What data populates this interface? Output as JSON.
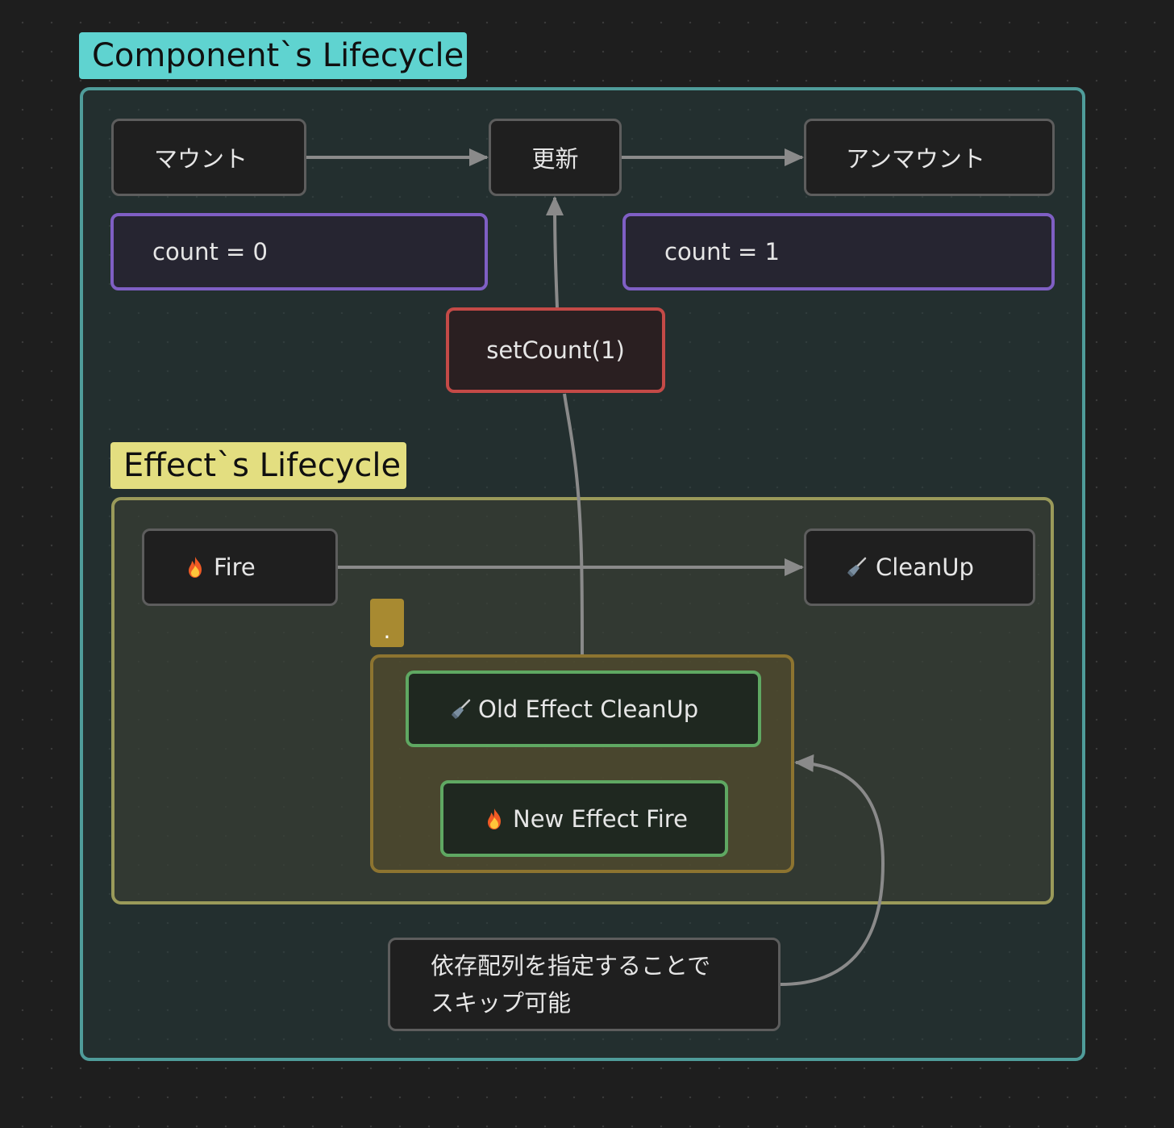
{
  "groups": {
    "component": {
      "label": "Component`s Lifecycle",
      "color": "#5fd3d0"
    },
    "effect": {
      "label": "Effect`s Lifecycle",
      "color": "#e3de80"
    },
    "inner": {
      "label": ".",
      "color": "#a88a31"
    }
  },
  "nodes": {
    "mount": "マウント",
    "update": "更新",
    "unmount": "アンマウント",
    "count0": "count = 0",
    "count1": "count = 1",
    "setcount": "setCount(1)",
    "fire": "Fire",
    "cleanup": "CleanUp",
    "old_cleanup": "Old Effect CleanUp",
    "new_fire": "New Effect Fire",
    "note_line1": "依存配列を指定することで",
    "note_line2": "スキップ可能"
  },
  "icons": {
    "fire": "fire-icon",
    "broom": "broom-icon"
  },
  "colors": {
    "count_border": "#7f5fc4",
    "setcount_border": "#c44a47",
    "green_border": "#5fa862",
    "node_border": "#5d5d5d",
    "edge": "#8a8a8a"
  }
}
